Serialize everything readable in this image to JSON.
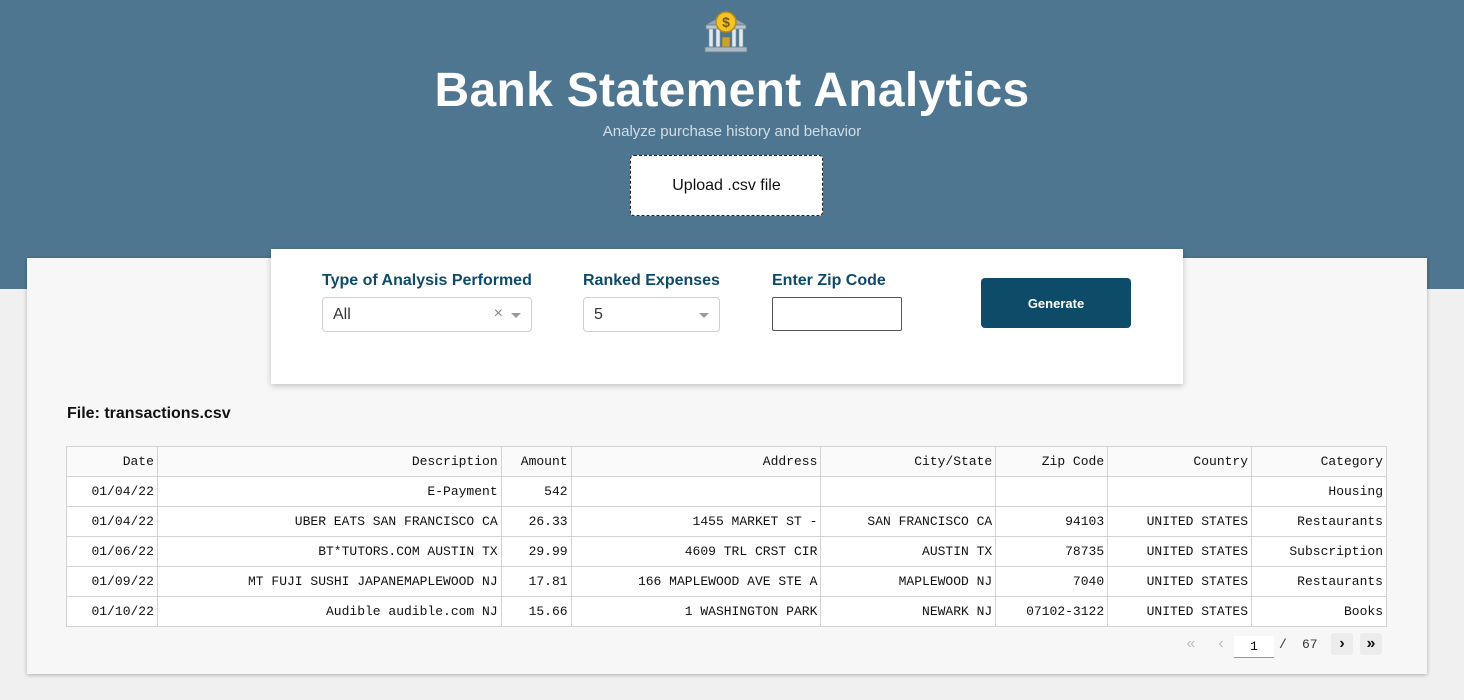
{
  "header": {
    "icon": "bank-icon",
    "title": "Bank Statement Analytics",
    "subtitle": "Analyze purchase history and behavior",
    "upload_label": "Upload .csv file"
  },
  "controls": {
    "analysis_label": "Type of Analysis Performed",
    "analysis_value": "All",
    "ranked_label": "Ranked Expenses",
    "ranked_value": "5",
    "zip_label": "Enter Zip Code",
    "zip_value": "",
    "generate_label": "Generate"
  },
  "file_label": "File: transactions.csv",
  "table": {
    "columns": [
      "Date",
      "Description",
      "Amount",
      "Address",
      "City/State",
      "Zip Code",
      "Country",
      "Category"
    ],
    "rows": [
      [
        "01/04/22",
        "E-Payment",
        "542",
        "",
        "",
        "",
        "",
        "Housing"
      ],
      [
        "01/04/22",
        "UBER EATS SAN FRANCISCO CA",
        "26.33",
        "1455 MARKET ST -",
        "SAN FRANCISCO CA",
        "94103",
        "UNITED STATES",
        "Restaurants"
      ],
      [
        "01/06/22",
        "BT*TUTORS.COM AUSTIN TX",
        "29.99",
        "4609 TRL CRST CIR",
        "AUSTIN TX",
        "78735",
        "UNITED STATES",
        "Subscription"
      ],
      [
        "01/09/22",
        "MT FUJI SUSHI JAPANEMAPLEWOOD NJ",
        "17.81",
        "166 MAPLEWOOD AVE STE A",
        "MAPLEWOOD NJ",
        "7040",
        "UNITED STATES",
        "Restaurants"
      ],
      [
        "01/10/22",
        "Audible audible.com NJ",
        "15.66",
        "1 WASHINGTON PARK",
        "NEWARK NJ",
        "07102-3122",
        "UNITED STATES",
        "Books"
      ]
    ]
  },
  "pagination": {
    "current_page": "1",
    "separator": "/",
    "total_pages": "67",
    "first_glyph": "«",
    "prev_glyph": "‹",
    "next_glyph": "›",
    "last_glyph": "»"
  },
  "colors": {
    "hero_bg": "#4f7690",
    "accent": "#0e4b69",
    "panel_bg": "#f7f7f7"
  }
}
